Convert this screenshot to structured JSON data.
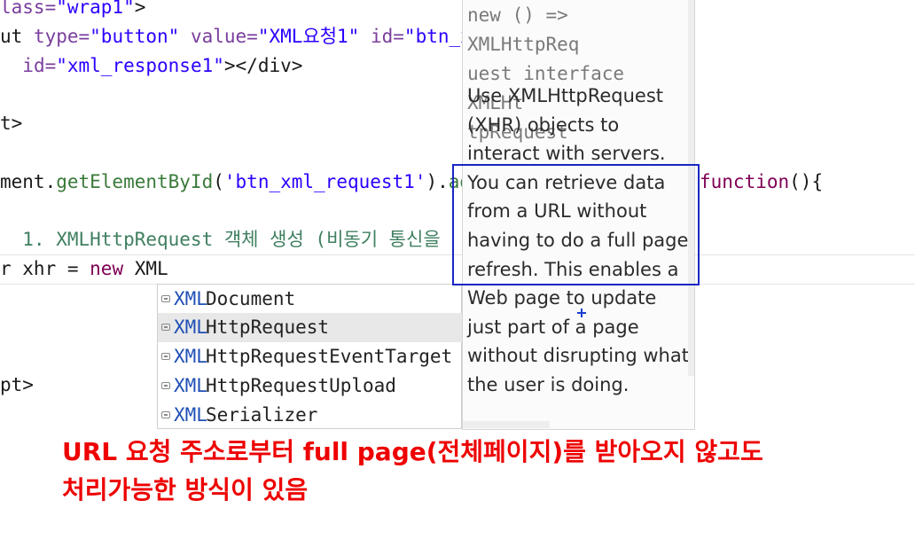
{
  "editor": {
    "line1": {
      "tag": "lass=",
      "value": "\"wrap1\"",
      "close": ">"
    },
    "line2": {
      "p1": "ut ",
      "a1": "type=",
      "v1": "\"button\"",
      "sp1": " ",
      "a2": "value=",
      "v2": "\"XML요청1\"",
      "sp2": " ",
      "a3": "id=",
      "v3": "\"btn_xm"
    },
    "line3": {
      "indent": "  ",
      "a1": "id=",
      "v1": "\"xml_response1\"",
      "close": "></div>"
    },
    "line4": {
      "text": "t>"
    },
    "line5": {
      "p1": "ment.",
      "m1": "getElementById",
      "p2": "(",
      "s1": "'btn_xml_request1'",
      "p3": ").",
      "m2": "addE",
      "kw": "function",
      "p4": "(){"
    },
    "line6": {
      "comment": "  1. XMLHttpRequest 객체 생성 (비동기 통신을"
    },
    "line7": {
      "p1": "r xhr = ",
      "kw": "new",
      "p2": " XML"
    },
    "line8": {
      "text": "pt>"
    }
  },
  "assist": {
    "prefix": "XML",
    "items": [
      {
        "match": "XML",
        "rest": "Document"
      },
      {
        "match": "XML",
        "rest": "HttpRequest"
      },
      {
        "match": "XML",
        "rest": "HttpRequestEventTarget"
      },
      {
        "match": "XML",
        "rest": "HttpRequestUpload"
      },
      {
        "match": "XML",
        "rest": "Serializer"
      }
    ],
    "selected_index": 1
  },
  "doc": {
    "signature_line1": "new () => XMLHttpReq",
    "signature_line2": "uest interface XMLHt",
    "signature_line3": "tpRequest",
    "body": "Use XMLHttpRequest (XHR) objects to interact with servers. You can retrieve data from a URL without having to do a full page refresh. This enables a Web page to update just part of a page without disrupting what the user is doing."
  },
  "annotation": {
    "line1": "URL 요청 주소로부터 full page(전체페이지)를 받아오지 않고도",
    "line2": "처리가능한 방식이 있음"
  },
  "colors": {
    "attribute": "#7a3e9d",
    "string": "#2a00ff",
    "keyword": "#7f0055",
    "method": "#3a7a3a",
    "match_highlight": "#1f4fb5",
    "annotation_red": "#ee0000",
    "highlight_box": "#1a25c4"
  }
}
